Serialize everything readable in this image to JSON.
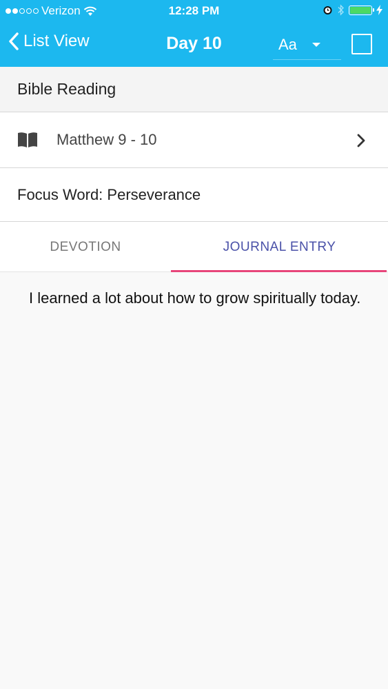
{
  "status_bar": {
    "carrier": "Verizon",
    "time": "12:28 PM",
    "signal_bars_filled": 2,
    "signal_bars_total": 5,
    "battery_level": 1.0
  },
  "nav": {
    "back_label": "List View",
    "title": "Day 10",
    "font_size_value": "Aa",
    "checkbox_checked": false
  },
  "section": {
    "title": "Bible Reading"
  },
  "reading": {
    "passage": "Matthew 9 - 10",
    "icon": "book-icon"
  },
  "focus": {
    "text": "Focus Word: Perseverance"
  },
  "tabs": [
    {
      "label": "DEVOTION",
      "active": false
    },
    {
      "label": "JOURNAL ENTRY",
      "active": true
    }
  ],
  "journal": {
    "text": "I learned a lot about how to grow spiritually today."
  },
  "colors": {
    "header": "#1cb8ef",
    "active_tab_text": "#4a51a8",
    "tab_indicator": "#e8457a",
    "battery": "#4cd964"
  }
}
